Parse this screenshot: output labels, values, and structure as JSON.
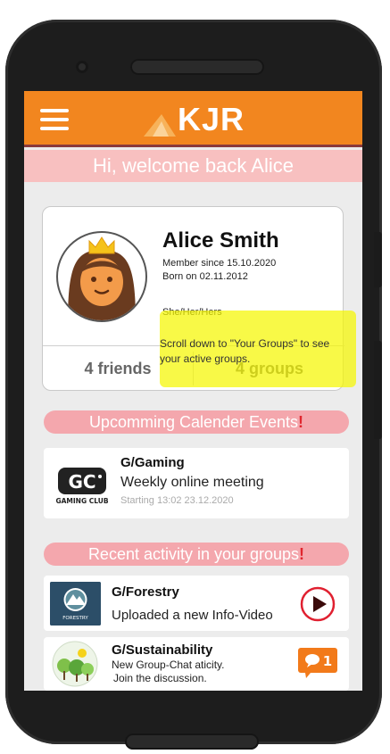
{
  "app": {
    "logo_text": "KJR"
  },
  "welcome": "Hi, welcome back Alice",
  "profile": {
    "name": "Alice Smith",
    "member_since": "Member since 15.10.2020",
    "born_on": "Born on 02.11.2012",
    "pronouns": "She/Her/Hers",
    "scroll_hint": "Scroll down to \"Your Groups\" to see your active groups.",
    "friends": "4 friends",
    "groups": "4 groups"
  },
  "events_section": {
    "title": "Upcomming Calender Events",
    "excl": "!",
    "items": [
      {
        "group": "G/Gaming",
        "title": "Weekly online meeting",
        "time": "Starting 13:02 23.12.2020",
        "logo_text": "GAMING CLUB"
      }
    ]
  },
  "activity_section": {
    "title": "Recent activity in your groups",
    "excl": "!",
    "items": [
      {
        "group": "G/Forestry",
        "text": "Uploaded a new Info-Video",
        "logo_text": "FORESTRY",
        "icon": "play-icon"
      },
      {
        "group": "G/Sustainability",
        "text_line1": "New Group-Chat aticity.",
        "text_line2": "Join the discussion.",
        "badge_count": "1",
        "icon": "chat-icon"
      }
    ]
  },
  "colors": {
    "topbar": "#f2861f",
    "welcome_bar": "#f8c0c0",
    "pill": "#f4a7ad",
    "highlight": "#f5f700",
    "chat_badge": "#f27a1a",
    "play_ring": "#e02030"
  }
}
